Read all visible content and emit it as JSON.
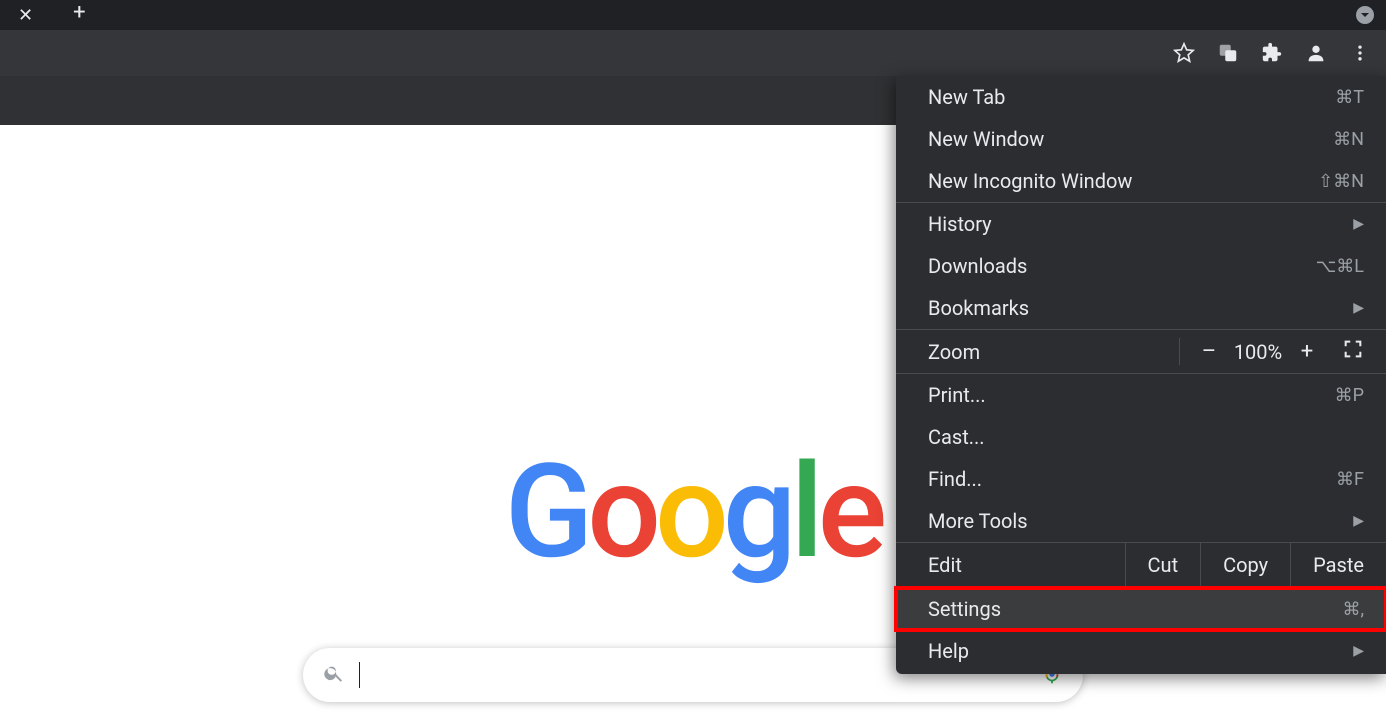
{
  "logo": {
    "letters": [
      "G",
      "o",
      "o",
      "g",
      "l",
      "e"
    ]
  },
  "search": {
    "value": "",
    "placeholder": ""
  },
  "menu": {
    "section1": [
      {
        "label": "New Tab",
        "shortcut": "⌘T"
      },
      {
        "label": "New Window",
        "shortcut": "⌘N"
      },
      {
        "label": "New Incognito Window",
        "shortcut": "⇧⌘N"
      }
    ],
    "section2": [
      {
        "label": "History",
        "submenu": true
      },
      {
        "label": "Downloads",
        "shortcut": "⌥⌘L"
      },
      {
        "label": "Bookmarks",
        "submenu": true
      }
    ],
    "zoom": {
      "label": "Zoom",
      "minus": "–",
      "pct": "100%",
      "plus": "+"
    },
    "section3": [
      {
        "label": "Print...",
        "shortcut": "⌘P"
      },
      {
        "label": "Cast..."
      },
      {
        "label": "Find...",
        "shortcut": "⌘F"
      },
      {
        "label": "More Tools",
        "submenu": true
      }
    ],
    "edit": {
      "label": "Edit",
      "cut": "Cut",
      "copy": "Copy",
      "paste": "Paste"
    },
    "settings": {
      "label": "Settings",
      "shortcut": "⌘,"
    },
    "help": {
      "label": "Help",
      "submenu": true
    }
  }
}
